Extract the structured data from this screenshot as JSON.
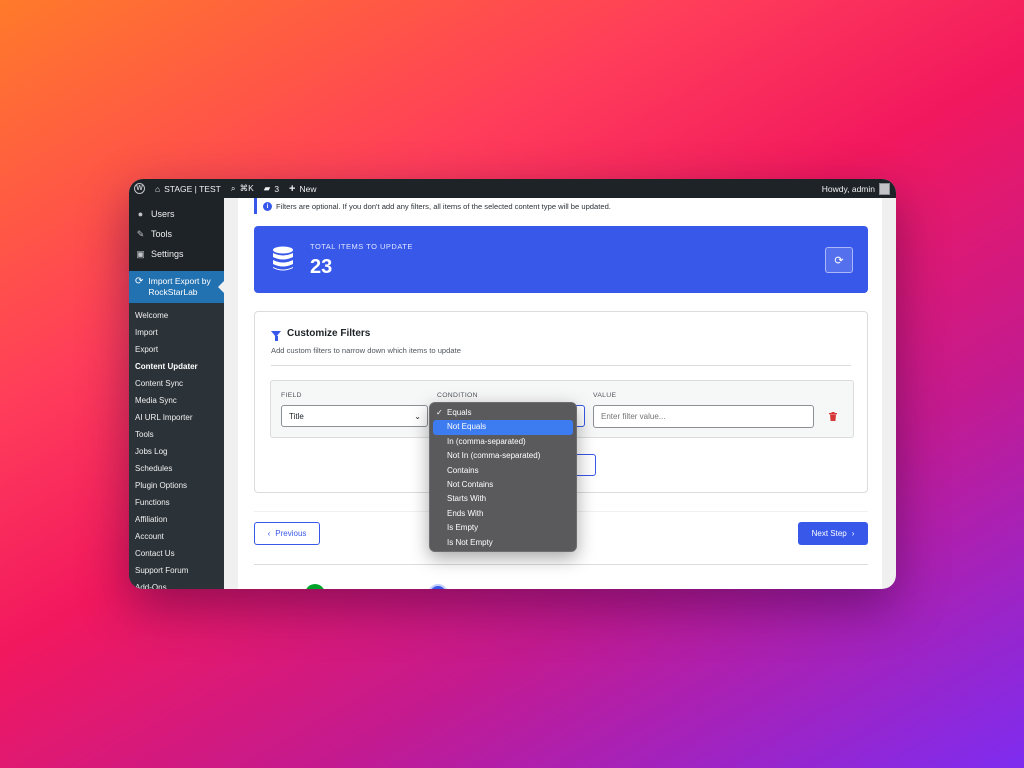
{
  "admin_bar": {
    "site_name": "STAGE | TEST",
    "search_shortcut": "⌘K",
    "comments_count": "3",
    "new_label": "New",
    "howdy": "Howdy, admin"
  },
  "sidebar": {
    "top_items": [
      {
        "label": "Users",
        "icon": "user-icon"
      },
      {
        "label": "Tools",
        "icon": "wrench-icon"
      },
      {
        "label": "Settings",
        "icon": "settings-icon"
      }
    ],
    "active_plugin": "Import Export by RockStarLab",
    "submenu": [
      "Welcome",
      "Import",
      "Export",
      "Content Updater",
      "Content Sync",
      "Media Sync",
      "AI URL Importer",
      "Tools",
      "Jobs Log",
      "Schedules",
      "Plugin Options",
      "Functions",
      "Affiliation",
      "Account",
      "Contact Us",
      "Support Forum",
      "Add-Ons"
    ],
    "current_submenu": "Content Updater"
  },
  "notice": "Filters are optional. If you don't add any filters, all items of the selected content type will be updated.",
  "stats": {
    "label": "TOTAL ITEMS TO UPDATE",
    "value": "23"
  },
  "filters": {
    "title": "Customize Filters",
    "subtitle": "Add custom filters to narrow down which items to update",
    "field_label": "FIELD",
    "condition_label": "CONDITION",
    "value_label": "VALUE",
    "field_value": "Title",
    "value_placeholder": "Enter filter value...",
    "add_filter_label": "Add Filter",
    "add_filter_visible": "ter"
  },
  "condition_dropdown": {
    "checked": "Equals",
    "highlighted": "Not Equals",
    "options": [
      "Equals",
      "Not Equals",
      "In (comma-separated)",
      "Not In (comma-separated)",
      "Contains",
      "Not Contains",
      "Starts With",
      "Ends With",
      "Is Empty",
      "Is Not Empty"
    ]
  },
  "navigation": {
    "previous_label": "Previous",
    "next_label": "Next Step"
  },
  "colors": {
    "accent": "#3858e9",
    "admin_bar": "#1d2327",
    "menu_active": "#2271b1",
    "danger": "#d63638",
    "success": "#00a32a"
  }
}
